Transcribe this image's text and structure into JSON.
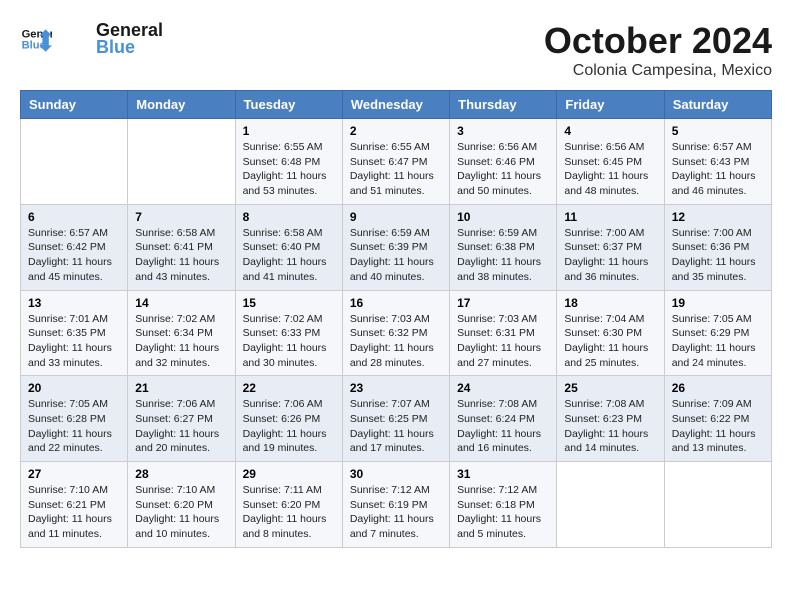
{
  "header": {
    "logo_line1": "General",
    "logo_line2": "Blue",
    "month_title": "October 2024",
    "subtitle": "Colonia Campesina, Mexico"
  },
  "days_of_week": [
    "Sunday",
    "Monday",
    "Tuesday",
    "Wednesday",
    "Thursday",
    "Friday",
    "Saturday"
  ],
  "weeks": [
    [
      {
        "day": "",
        "info": ""
      },
      {
        "day": "",
        "info": ""
      },
      {
        "day": "1",
        "info": "Sunrise: 6:55 AM\nSunset: 6:48 PM\nDaylight: 11 hours and 53 minutes."
      },
      {
        "day": "2",
        "info": "Sunrise: 6:55 AM\nSunset: 6:47 PM\nDaylight: 11 hours and 51 minutes."
      },
      {
        "day": "3",
        "info": "Sunrise: 6:56 AM\nSunset: 6:46 PM\nDaylight: 11 hours and 50 minutes."
      },
      {
        "day": "4",
        "info": "Sunrise: 6:56 AM\nSunset: 6:45 PM\nDaylight: 11 hours and 48 minutes."
      },
      {
        "day": "5",
        "info": "Sunrise: 6:57 AM\nSunset: 6:43 PM\nDaylight: 11 hours and 46 minutes."
      }
    ],
    [
      {
        "day": "6",
        "info": "Sunrise: 6:57 AM\nSunset: 6:42 PM\nDaylight: 11 hours and 45 minutes."
      },
      {
        "day": "7",
        "info": "Sunrise: 6:58 AM\nSunset: 6:41 PM\nDaylight: 11 hours and 43 minutes."
      },
      {
        "day": "8",
        "info": "Sunrise: 6:58 AM\nSunset: 6:40 PM\nDaylight: 11 hours and 41 minutes."
      },
      {
        "day": "9",
        "info": "Sunrise: 6:59 AM\nSunset: 6:39 PM\nDaylight: 11 hours and 40 minutes."
      },
      {
        "day": "10",
        "info": "Sunrise: 6:59 AM\nSunset: 6:38 PM\nDaylight: 11 hours and 38 minutes."
      },
      {
        "day": "11",
        "info": "Sunrise: 7:00 AM\nSunset: 6:37 PM\nDaylight: 11 hours and 36 minutes."
      },
      {
        "day": "12",
        "info": "Sunrise: 7:00 AM\nSunset: 6:36 PM\nDaylight: 11 hours and 35 minutes."
      }
    ],
    [
      {
        "day": "13",
        "info": "Sunrise: 7:01 AM\nSunset: 6:35 PM\nDaylight: 11 hours and 33 minutes."
      },
      {
        "day": "14",
        "info": "Sunrise: 7:02 AM\nSunset: 6:34 PM\nDaylight: 11 hours and 32 minutes."
      },
      {
        "day": "15",
        "info": "Sunrise: 7:02 AM\nSunset: 6:33 PM\nDaylight: 11 hours and 30 minutes."
      },
      {
        "day": "16",
        "info": "Sunrise: 7:03 AM\nSunset: 6:32 PM\nDaylight: 11 hours and 28 minutes."
      },
      {
        "day": "17",
        "info": "Sunrise: 7:03 AM\nSunset: 6:31 PM\nDaylight: 11 hours and 27 minutes."
      },
      {
        "day": "18",
        "info": "Sunrise: 7:04 AM\nSunset: 6:30 PM\nDaylight: 11 hours and 25 minutes."
      },
      {
        "day": "19",
        "info": "Sunrise: 7:05 AM\nSunset: 6:29 PM\nDaylight: 11 hours and 24 minutes."
      }
    ],
    [
      {
        "day": "20",
        "info": "Sunrise: 7:05 AM\nSunset: 6:28 PM\nDaylight: 11 hours and 22 minutes."
      },
      {
        "day": "21",
        "info": "Sunrise: 7:06 AM\nSunset: 6:27 PM\nDaylight: 11 hours and 20 minutes."
      },
      {
        "day": "22",
        "info": "Sunrise: 7:06 AM\nSunset: 6:26 PM\nDaylight: 11 hours and 19 minutes."
      },
      {
        "day": "23",
        "info": "Sunrise: 7:07 AM\nSunset: 6:25 PM\nDaylight: 11 hours and 17 minutes."
      },
      {
        "day": "24",
        "info": "Sunrise: 7:08 AM\nSunset: 6:24 PM\nDaylight: 11 hours and 16 minutes."
      },
      {
        "day": "25",
        "info": "Sunrise: 7:08 AM\nSunset: 6:23 PM\nDaylight: 11 hours and 14 minutes."
      },
      {
        "day": "26",
        "info": "Sunrise: 7:09 AM\nSunset: 6:22 PM\nDaylight: 11 hours and 13 minutes."
      }
    ],
    [
      {
        "day": "27",
        "info": "Sunrise: 7:10 AM\nSunset: 6:21 PM\nDaylight: 11 hours and 11 minutes."
      },
      {
        "day": "28",
        "info": "Sunrise: 7:10 AM\nSunset: 6:20 PM\nDaylight: 11 hours and 10 minutes."
      },
      {
        "day": "29",
        "info": "Sunrise: 7:11 AM\nSunset: 6:20 PM\nDaylight: 11 hours and 8 minutes."
      },
      {
        "day": "30",
        "info": "Sunrise: 7:12 AM\nSunset: 6:19 PM\nDaylight: 11 hours and 7 minutes."
      },
      {
        "day": "31",
        "info": "Sunrise: 7:12 AM\nSunset: 6:18 PM\nDaylight: 11 hours and 5 minutes."
      },
      {
        "day": "",
        "info": ""
      },
      {
        "day": "",
        "info": ""
      }
    ]
  ]
}
